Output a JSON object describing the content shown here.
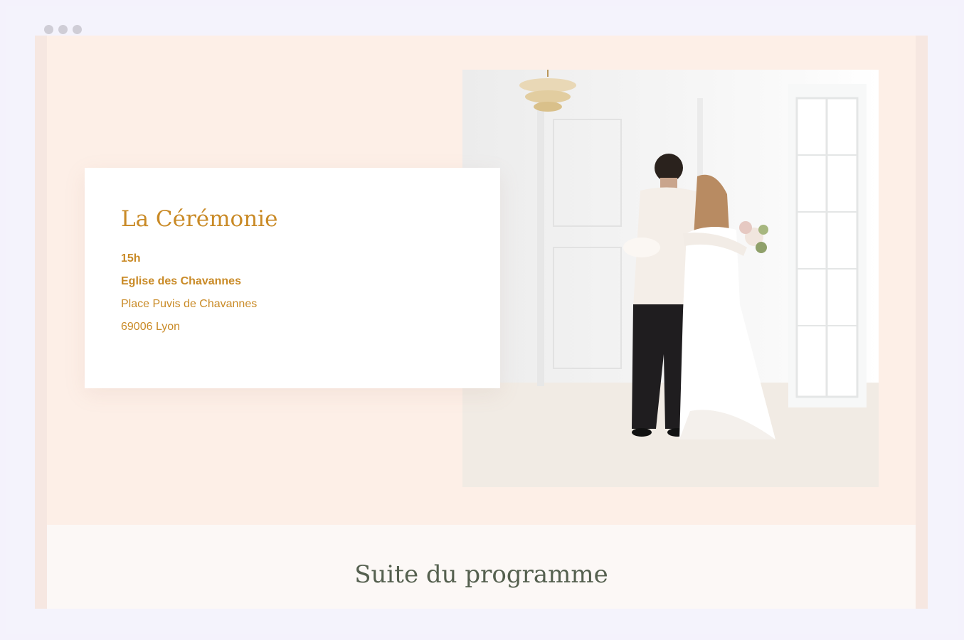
{
  "ceremony": {
    "title": "La Cérémonie",
    "time": "15h",
    "venue": "Eglise des Chavannes",
    "street": "Place Puvis de Chavannes",
    "city": "69006 Lyon"
  },
  "next_section": {
    "title": "Suite du programme"
  },
  "colors": {
    "accent": "#c98a26",
    "hero_background": "#fdefe7",
    "heading_green": "#55604f"
  }
}
